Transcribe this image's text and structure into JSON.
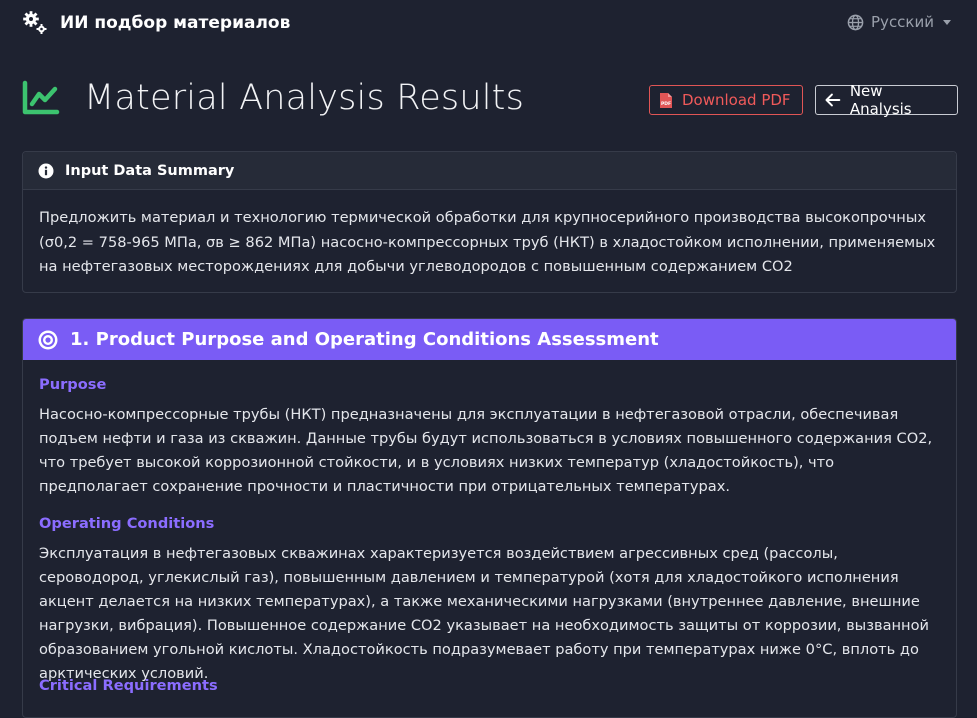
{
  "navbar": {
    "brand_title": "ИИ подбор материалов",
    "brand_icon": "gears-icon",
    "language": "Русский",
    "language_icon": "globe-icon"
  },
  "header": {
    "title": "Material Analysis Results",
    "title_icon": "line-chart-icon",
    "download_label": "Download PDF",
    "download_icon": "pdf-file-icon",
    "new_analysis_label": "New Analysis",
    "new_analysis_icon": "arrow-left-icon"
  },
  "summary": {
    "heading": "Input Data Summary",
    "icon": "info-circle-icon",
    "text": "Предложить материал и технологию термической обработки для крупносерийного производства высокопрочных (σ0,2 = 758-965 МПа, σв ≥ 862 МПа) насосно-компрессорных труб (НКТ) в хладостойком исполнении, применяемых на нефтегазовых месторождениях для добычи углеводородов с повышенным содержанием CO2"
  },
  "section1": {
    "title": "1. Product Purpose and Operating Conditions Assessment",
    "icon": "bullseye-icon",
    "purpose_heading": "Purpose",
    "purpose_text": "Насосно-компрессорные трубы (НКТ) предназначены для эксплуатации в нефтегазовой отрасли, обеспечивая подъем нефти и газа из скважин. Данные трубы будут использоваться в условиях повышенного содержания CO2, что требует высокой коррозионной стойкости, и в условиях низких температур (хладостойкость), что предполагает сохранение прочности и пластичности при отрицательных температурах.",
    "conditions_heading": "Operating Conditions",
    "conditions_text": "Эксплуатация в нефтегазовых скважинах характеризуется воздействием агрессивных сред (рассолы, сероводород, углекислый газ), повышенным давлением и температурой (хотя для хладостойкого исполнения акцент делается на низких температурах), а также механическими нагрузками (внутреннее давление, внешние нагрузки, вибрация). Повышенное содержание CO2 указывает на необходимость защиты от коррозии, вызванной образованием угольной кислоты. Хладостойкость подразумевает работу при температурах ниже 0°C, вплоть до арктических условий.",
    "requirements_heading": "Critical Requirements"
  },
  "colors": {
    "background": "#1e2230",
    "accent_purple": "#7a5cf5",
    "subheading_purple": "#8b6dff",
    "pdf_red": "#e05555",
    "chart_green": "#3cc36f"
  }
}
